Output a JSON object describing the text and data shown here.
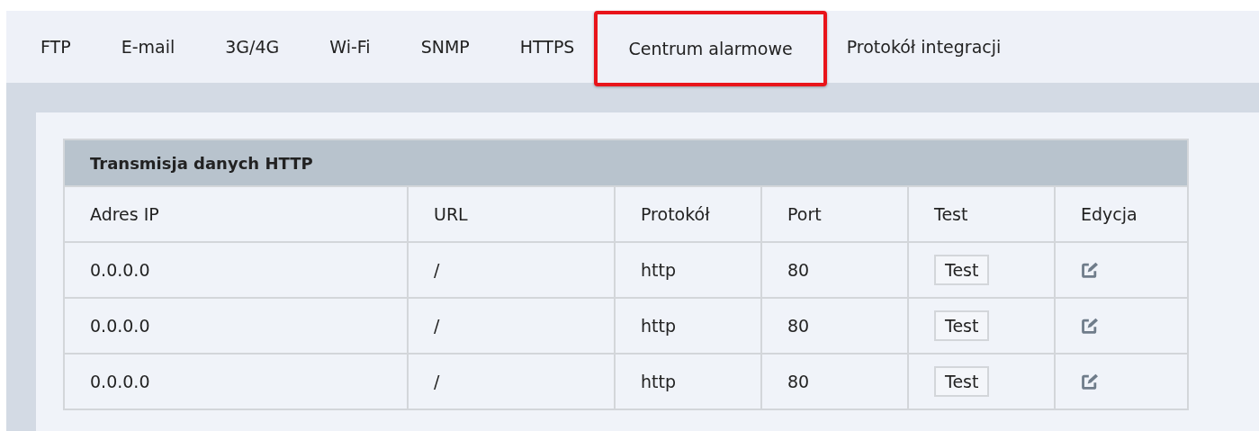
{
  "tabs": [
    {
      "label": "FTP",
      "selected": false
    },
    {
      "label": "E-mail",
      "selected": false
    },
    {
      "label": "3G/4G",
      "selected": false
    },
    {
      "label": "Wi-Fi",
      "selected": false
    },
    {
      "label": "SNMP",
      "selected": false
    },
    {
      "label": "HTTPS",
      "selected": false
    },
    {
      "label": "Centrum alarmowe",
      "selected": true
    },
    {
      "label": "Protokół integracji",
      "selected": false
    }
  ],
  "table": {
    "title": "Transmisja danych HTTP",
    "columns": [
      "Adres IP",
      "URL",
      "Protokół",
      "Port",
      "Test",
      "Edycja"
    ],
    "rows": [
      {
        "ip": "0.0.0.0",
        "url": "/",
        "protocol": "http",
        "port": "80",
        "test_button": "Test"
      },
      {
        "ip": "0.0.0.0",
        "url": "/",
        "protocol": "http",
        "port": "80",
        "test_button": "Test"
      },
      {
        "ip": "0.0.0.0",
        "url": "/",
        "protocol": "http",
        "port": "80",
        "test_button": "Test"
      }
    ]
  }
}
